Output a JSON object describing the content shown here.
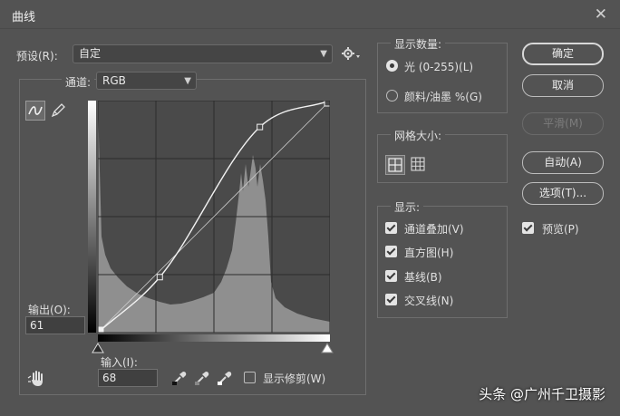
{
  "window": {
    "title": "曲线",
    "close_symbol": "✕"
  },
  "preset": {
    "label": "预设(R):",
    "value": "自定"
  },
  "channel": {
    "label": "通道:",
    "value": "RGB"
  },
  "output": {
    "label": "输出(O):",
    "value": "61"
  },
  "input": {
    "label": "输入(I):",
    "value": "68"
  },
  "show_clipping": {
    "label": "显示修剪(W)",
    "checked": false
  },
  "show_amount": {
    "title": "显示数量:",
    "options": [
      {
        "label": "光 (0-255)(L)",
        "selected": true
      },
      {
        "label": "颜料/油墨 %(G)",
        "selected": false
      }
    ]
  },
  "grid_size": {
    "title": "网格大小:"
  },
  "show": {
    "title": "显示:",
    "items": [
      {
        "label": "通道叠加(V)",
        "checked": true
      },
      {
        "label": "直方图(H)",
        "checked": true
      },
      {
        "label": "基线(B)",
        "checked": true
      },
      {
        "label": "交叉线(N)",
        "checked": true
      }
    ]
  },
  "buttons": {
    "ok": "确定",
    "cancel": "取消",
    "smooth": "平滑(M)",
    "auto": "自动(A)",
    "options": "选项(T)..."
  },
  "preview": {
    "label": "预览(P)",
    "checked": true
  },
  "curve": {
    "control_points": [
      [
        0,
        0
      ],
      [
        68,
        61
      ],
      [
        178,
        226
      ],
      [
        255,
        255
      ]
    ],
    "selected_point": [
      0,
      0
    ]
  },
  "watermark": "头条 @广州千卫摄影",
  "colors": {
    "dialog_bg": "#535353",
    "graph_bg": "#4a4a4a",
    "histogram": "#8f8f8f",
    "curve": "#f2f2f2"
  }
}
